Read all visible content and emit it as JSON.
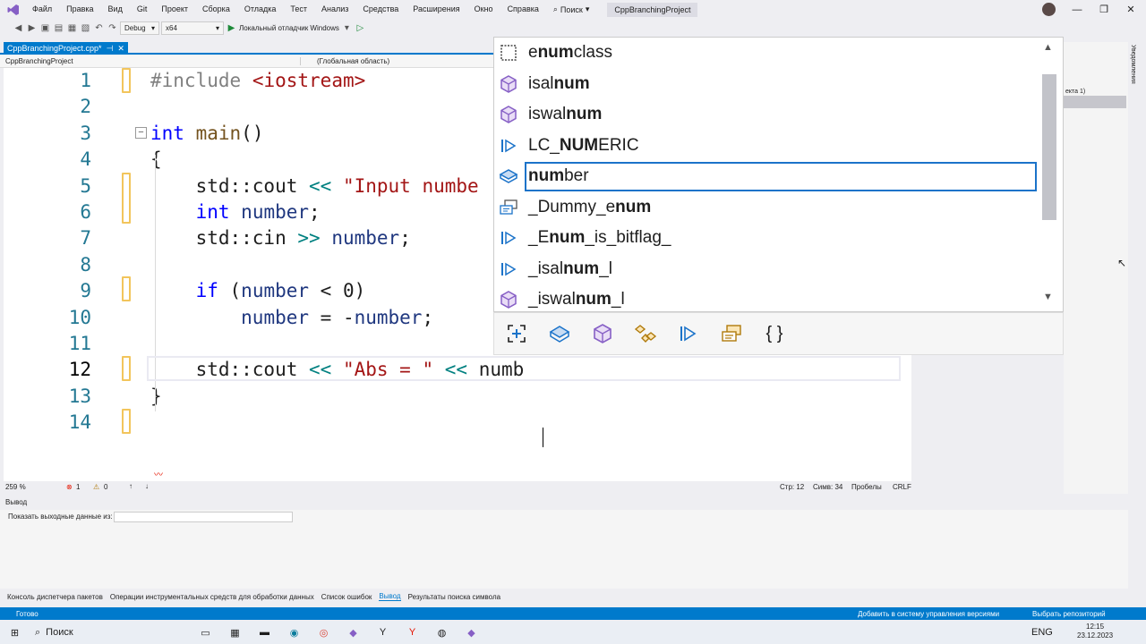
{
  "menu": {
    "items": [
      "Файл",
      "Правка",
      "Вид",
      "Git",
      "Проект",
      "Сборка",
      "Отладка",
      "Тест",
      "Анализ",
      "Средства",
      "Расширения",
      "Окно",
      "Справка"
    ],
    "search_label": "Поиск",
    "project_title": "CppBranchingProject"
  },
  "window_controls": {
    "minimize": "—",
    "maximize": "❐",
    "close": "✕"
  },
  "toolbar": {
    "config": "Debug",
    "platform": "x64",
    "debugger": "Локальный отладчик Windows"
  },
  "tab": {
    "file": "CppBranchingProject.cpp*",
    "pin": "⊣",
    "close": "✕"
  },
  "navbar": {
    "project": "CppBranchingProject",
    "scope": "(Глобальная область)"
  },
  "editor": {
    "lines": [
      {
        "n": "1",
        "code": "#include <iostream>"
      },
      {
        "n": "2",
        "code": ""
      },
      {
        "n": "3",
        "code": "int main()"
      },
      {
        "n": "4",
        "code": "{"
      },
      {
        "n": "5",
        "code": "    std::cout << \"Input numbe"
      },
      {
        "n": "6",
        "code": "    int number;"
      },
      {
        "n": "7",
        "code": "    std::cin >> number;"
      },
      {
        "n": "8",
        "code": ""
      },
      {
        "n": "9",
        "code": "    if (number < 0)"
      },
      {
        "n": "10",
        "code": "        number = -number;"
      },
      {
        "n": "11",
        "code": ""
      },
      {
        "n": "12",
        "code": "    std::cout << \"Abs = \" << numb"
      },
      {
        "n": "13",
        "code": "}"
      },
      {
        "n": "14",
        "code": ""
      }
    ]
  },
  "autocomplete": {
    "items": [
      {
        "pre": "e",
        "match": "num",
        "post": "class",
        "icon": "enum-class-icon"
      },
      {
        "pre": "isal",
        "match": "num",
        "post": "",
        "icon": "function-icon"
      },
      {
        "pre": "iswal",
        "match": "num",
        "post": "",
        "icon": "function-icon"
      },
      {
        "pre": "LC_",
        "match": "NUM",
        "post": "ERIC",
        "icon": "macro-icon"
      },
      {
        "pre": "",
        "match": "num",
        "post": "ber",
        "icon": "variable-icon"
      },
      {
        "pre": "_Dummy_e",
        "match": "num",
        "post": "",
        "icon": "enum-icon"
      },
      {
        "pre": "_E",
        "match": "num",
        "post": "_is_bitflag_",
        "icon": "macro-icon"
      },
      {
        "pre": "_isal",
        "match": "num",
        "post": "_l",
        "icon": "macro-icon"
      },
      {
        "pre": "_iswal",
        "match": "num",
        "post": "_l",
        "icon": "function-icon"
      }
    ],
    "selected_index": 4,
    "filters": [
      "namespace-filter-icon",
      "variable-filter-icon",
      "function-filter-icon",
      "type-filter-icon",
      "macro-filter-icon",
      "enum-filter-icon",
      "snippet-filter-icon"
    ],
    "braces": "{ }"
  },
  "editor_status": {
    "zoom": "259 %",
    "errors": "1",
    "warnings": "0",
    "line": "Стр: 12",
    "col": "Симв: 34",
    "spacing": "Пробелы",
    "eol": "CRLF"
  },
  "output": {
    "title": "Вывод",
    "show_from": "Показать выходные данные из:"
  },
  "bottom_tabs": [
    "Консоль диспетчера пакетов",
    "Операции инструментальных средств для обработки данных",
    "Список ошибок",
    "Вывод",
    "Результаты поиска символа"
  ],
  "statusbar": {
    "ready": "Готово",
    "vcs": "Добавить в систему управления версиями",
    "repo": "Выбрать репозиторий"
  },
  "side": {
    "notifications": "Уведомления",
    "right_label": "екта 1)"
  },
  "taskbar": {
    "search": "Поиск",
    "lang": "ENG",
    "time": "12:15",
    "date": "23.12.2023"
  },
  "colors": {
    "accent": "#007acc",
    "keyword": "#0000ff",
    "string": "#a31515",
    "change_marker": "#f2c55c"
  }
}
